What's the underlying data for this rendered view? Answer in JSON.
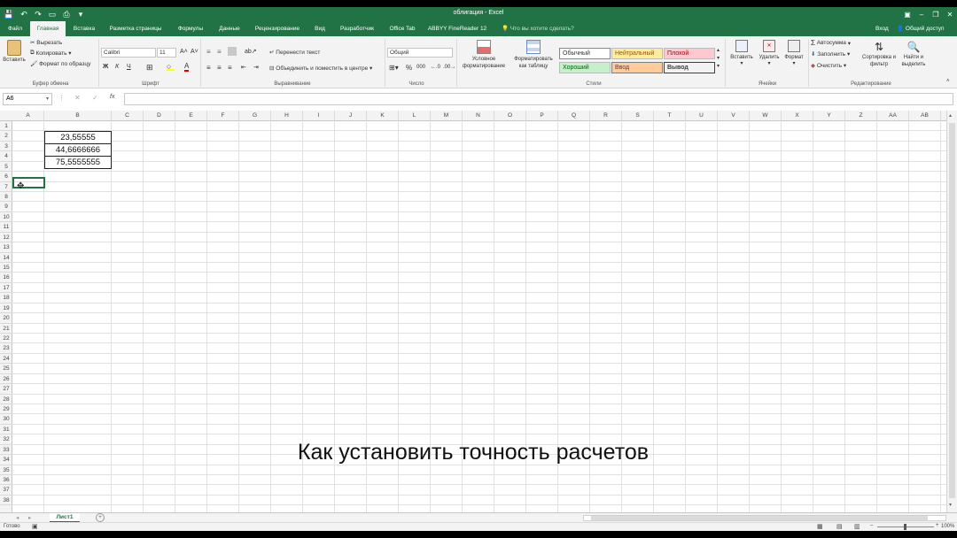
{
  "window": {
    "title": "облигация - Excel"
  },
  "tabs": [
    {
      "label": "Файл"
    },
    {
      "label": "Главная"
    },
    {
      "label": "Вставка"
    },
    {
      "label": "Разметка страницы"
    },
    {
      "label": "Формулы"
    },
    {
      "label": "Данные"
    },
    {
      "label": "Рецензирование"
    },
    {
      "label": "Вид"
    },
    {
      "label": "Разработчик"
    },
    {
      "label": "Office Tab"
    },
    {
      "label": "ABBYY FineReader 12"
    }
  ],
  "tell_me": "Что вы хотите сделать?",
  "account": {
    "signin": "Вход",
    "share": "Общий доступ"
  },
  "ribbon": {
    "clipboard": {
      "paste": "Вставить",
      "cut": "Вырезать",
      "copy": "Копировать",
      "format_painter": "Формат по образцу",
      "label": "Буфер обмена"
    },
    "font": {
      "name": "Calibri",
      "size": "11",
      "bold": "Ж",
      "italic": "К",
      "underline": "Ч",
      "label": "Шрифт"
    },
    "alignment": {
      "wrap": "Перенести текст",
      "merge": "Объединить и поместить в центре",
      "label": "Выравнивание"
    },
    "number": {
      "format": "Общий",
      "percent": "%",
      "thousands": "000",
      "label": "Число"
    },
    "styles": {
      "conditional": "Условное форматирование",
      "as_table": "Форматировать как таблицу",
      "cells": [
        "Обычный",
        "Нейтральный",
        "Плохой",
        "Хороший",
        "Ввод",
        "Вывод"
      ],
      "label": "Стили"
    },
    "cells": {
      "insert": "Вставить",
      "delete": "Удалить",
      "format": "Формат",
      "label": "Ячейки"
    },
    "editing": {
      "autosum": "Автосумма",
      "fill": "Заполнить",
      "clear": "Очистить",
      "sort": "Сортировка и фильтр",
      "find": "Найти и выделить",
      "label": "Редактирование"
    }
  },
  "formula_bar": {
    "name_box": "A6",
    "fx": "fx",
    "value": ""
  },
  "columns": [
    "A",
    "B",
    "C",
    "D",
    "E",
    "F",
    "G",
    "H",
    "I",
    "J",
    "K",
    "L",
    "M",
    "N",
    "O",
    "P",
    "Q",
    "R",
    "S",
    "T",
    "U",
    "V",
    "W",
    "X",
    "Y",
    "Z",
    "AA",
    "AB"
  ],
  "rows": [
    "1",
    "2",
    "3",
    "4",
    "5",
    "6",
    "7",
    "8",
    "9",
    "10",
    "11",
    "12",
    "13",
    "14",
    "15",
    "16",
    "17",
    "18",
    "19",
    "20",
    "21",
    "22",
    "23",
    "24",
    "25",
    "26",
    "27",
    "28",
    "29",
    "30",
    "31",
    "32",
    "33",
    "34",
    "35",
    "36",
    "37",
    "38"
  ],
  "cells": {
    "B2": "23,55555",
    "B3": "44,6666666",
    "B4": "75,5555555"
  },
  "overlay_caption": "Как установить точность расчетов",
  "sheet": {
    "name": "Лист1",
    "add": "+"
  },
  "status": {
    "ready": "Готово",
    "zoom": "100%"
  },
  "colors": {
    "accent": "#217346"
  }
}
